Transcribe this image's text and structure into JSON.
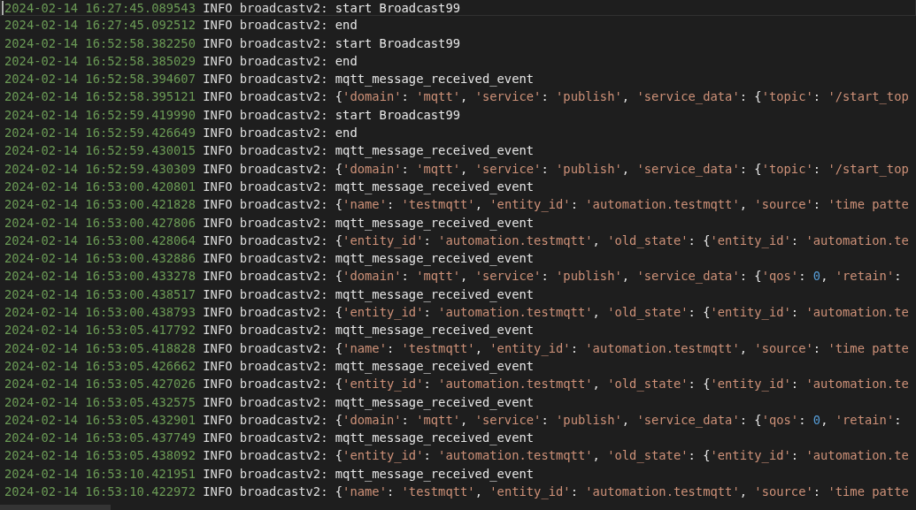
{
  "log_lines": [
    {
      "timestamp": "2024-02-14 16:27:45.089543",
      "severity": "INFO",
      "logger": "broadcastv2:",
      "message": "start Broadcast99",
      "current_line": true
    },
    {
      "timestamp": "2024-02-14 16:27:45.092512",
      "severity": "INFO",
      "logger": "broadcastv2:",
      "message": "end",
      "current_line": false
    },
    {
      "timestamp": "2024-02-14 16:52:58.382250",
      "severity": "INFO",
      "logger": "broadcastv2:",
      "message": "start Broadcast99",
      "current_line": false
    },
    {
      "timestamp": "2024-02-14 16:52:58.385029",
      "severity": "INFO",
      "logger": "broadcastv2:",
      "message": "end",
      "current_line": false
    },
    {
      "timestamp": "2024-02-14 16:52:58.394607",
      "severity": "INFO",
      "logger": "broadcastv2:",
      "message": "mqtt_message_received_event",
      "current_line": false
    },
    {
      "timestamp": "2024-02-14 16:52:58.395121",
      "severity": "INFO",
      "logger": "broadcastv2:",
      "message": "{'domain': 'mqtt', 'service': 'publish', 'service_data': {'topic': '/start_top",
      "current_line": false
    },
    {
      "timestamp": "2024-02-14 16:52:59.419990",
      "severity": "INFO",
      "logger": "broadcastv2:",
      "message": "start Broadcast99",
      "current_line": false
    },
    {
      "timestamp": "2024-02-14 16:52:59.426649",
      "severity": "INFO",
      "logger": "broadcastv2:",
      "message": "end",
      "current_line": false
    },
    {
      "timestamp": "2024-02-14 16:52:59.430015",
      "severity": "INFO",
      "logger": "broadcastv2:",
      "message": "mqtt_message_received_event",
      "current_line": false
    },
    {
      "timestamp": "2024-02-14 16:52:59.430309",
      "severity": "INFO",
      "logger": "broadcastv2:",
      "message": "{'domain': 'mqtt', 'service': 'publish', 'service_data': {'topic': '/start_top",
      "current_line": false
    },
    {
      "timestamp": "2024-02-14 16:53:00.420801",
      "severity": "INFO",
      "logger": "broadcastv2:",
      "message": "mqtt_message_received_event",
      "current_line": false
    },
    {
      "timestamp": "2024-02-14 16:53:00.421828",
      "severity": "INFO",
      "logger": "broadcastv2:",
      "message": "{'name': 'testmqtt', 'entity_id': 'automation.testmqtt', 'source': 'time patte",
      "current_line": false
    },
    {
      "timestamp": "2024-02-14 16:53:00.427806",
      "severity": "INFO",
      "logger": "broadcastv2:",
      "message": "mqtt_message_received_event",
      "current_line": false
    },
    {
      "timestamp": "2024-02-14 16:53:00.428064",
      "severity": "INFO",
      "logger": "broadcastv2:",
      "message": "{'entity_id': 'automation.testmqtt', 'old_state': {'entity_id': 'automation.te",
      "current_line": false
    },
    {
      "timestamp": "2024-02-14 16:53:00.432886",
      "severity": "INFO",
      "logger": "broadcastv2:",
      "message": "mqtt_message_received_event",
      "current_line": false
    },
    {
      "timestamp": "2024-02-14 16:53:00.433278",
      "severity": "INFO",
      "logger": "broadcastv2:",
      "message": "{'domain': 'mqtt', 'service': 'publish', 'service_data': {'qos': 0, 'retain':",
      "current_line": false
    },
    {
      "timestamp": "2024-02-14 16:53:00.438517",
      "severity": "INFO",
      "logger": "broadcastv2:",
      "message": "mqtt_message_received_event",
      "current_line": false
    },
    {
      "timestamp": "2024-02-14 16:53:00.438793",
      "severity": "INFO",
      "logger": "broadcastv2:",
      "message": "{'entity_id': 'automation.testmqtt', 'old_state': {'entity_id': 'automation.te",
      "current_line": false
    },
    {
      "timestamp": "2024-02-14 16:53:05.417792",
      "severity": "INFO",
      "logger": "broadcastv2:",
      "message": "mqtt_message_received_event",
      "current_line": false
    },
    {
      "timestamp": "2024-02-14 16:53:05.418828",
      "severity": "INFO",
      "logger": "broadcastv2:",
      "message": "{'name': 'testmqtt', 'entity_id': 'automation.testmqtt', 'source': 'time patte",
      "current_line": false
    },
    {
      "timestamp": "2024-02-14 16:53:05.426662",
      "severity": "INFO",
      "logger": "broadcastv2:",
      "message": "mqtt_message_received_event",
      "current_line": false
    },
    {
      "timestamp": "2024-02-14 16:53:05.427026",
      "severity": "INFO",
      "logger": "broadcastv2:",
      "message": "{'entity_id': 'automation.testmqtt', 'old_state': {'entity_id': 'automation.te",
      "current_line": false
    },
    {
      "timestamp": "2024-02-14 16:53:05.432575",
      "severity": "INFO",
      "logger": "broadcastv2:",
      "message": "mqtt_message_received_event",
      "current_line": false
    },
    {
      "timestamp": "2024-02-14 16:53:05.432901",
      "severity": "INFO",
      "logger": "broadcastv2:",
      "message": "{'domain': 'mqtt', 'service': 'publish', 'service_data': {'qos': 0, 'retain':",
      "current_line": false
    },
    {
      "timestamp": "2024-02-14 16:53:05.437749",
      "severity": "INFO",
      "logger": "broadcastv2:",
      "message": "mqtt_message_received_event",
      "current_line": false
    },
    {
      "timestamp": "2024-02-14 16:53:05.438092",
      "severity": "INFO",
      "logger": "broadcastv2:",
      "message": "{'entity_id': 'automation.testmqtt', 'old_state': {'entity_id': 'automation.te",
      "current_line": false
    },
    {
      "timestamp": "2024-02-14 16:53:10.421951",
      "severity": "INFO",
      "logger": "broadcastv2:",
      "message": "mqtt_message_received_event",
      "current_line": false
    },
    {
      "timestamp": "2024-02-14 16:53:10.422972",
      "severity": "INFO",
      "logger": "broadcastv2:",
      "message": "{'name': 'testmqtt', 'entity_id': 'automation.testmqtt', 'source': 'time patte",
      "current_line": false
    }
  ]
}
